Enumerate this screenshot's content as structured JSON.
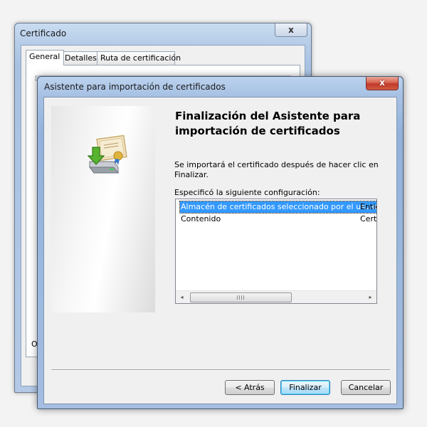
{
  "background_window": {
    "title": "Certificado",
    "close_label": "x",
    "tabs": [
      {
        "label": "General"
      },
      {
        "label": "Detalles"
      },
      {
        "label": "Ruta de certificación"
      }
    ],
    "partial_text": "O"
  },
  "wizard": {
    "title": "Asistente para importación de certificados",
    "close_label": "x",
    "heading": "Finalización del Asistente para importación de certificados",
    "info_text": "Se importará el certificado después de hacer clic en Finalizar.",
    "config_label": "Especificó la siguiente configuración:",
    "settings": [
      {
        "name": "Almacén de certificados seleccionado por el usuario",
        "value": "Entic",
        "selected": true
      },
      {
        "name": "Contenido",
        "value": "Cert",
        "selected": false
      }
    ],
    "scroll_arrows": {
      "left": "◂",
      "right": "▸"
    },
    "buttons": {
      "back": "< Atrás",
      "finish": "Finalizar",
      "cancel": "Cancelar"
    }
  },
  "colors": {
    "selection": "#3399ff",
    "close_button": "#c0392b"
  },
  "icons": [
    "certificate-install-icon"
  ]
}
